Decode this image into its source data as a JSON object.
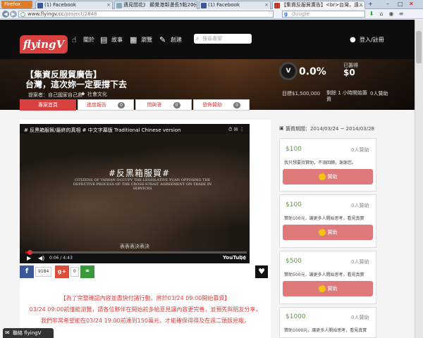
{
  "browser": {
    "menu_button": "Firefox",
    "tabs": [
      {
        "label": "(1) Facebook",
        "active": false
      },
      {
        "label": "遇見間花》 顯覺港鄰漫長5點20分轉...",
        "active": false
      },
      {
        "label": "(1) Facebook",
        "active": false
      },
      {
        "label": "【集資反服貿廣告】<br>台灣，遠...",
        "active": true
      }
    ],
    "url_host": "www.flyingv.cc",
    "url_path": "/project/2848",
    "search_placeholder": "Google"
  },
  "site": {
    "logo": "flyingV",
    "menu": [
      {
        "label": "關於",
        "icon": "hand-icon"
      },
      {
        "label": "故事",
        "icon": "book-icon"
      },
      {
        "label": "瀏覽",
        "icon": "grid-icon"
      },
      {
        "label": "創建",
        "icon": "edit-icon"
      }
    ],
    "search_placeholder": "搜尋專案",
    "login_label": "登入/註冊"
  },
  "project": {
    "title_line1": "【集資反服貿廣告】",
    "title_line2": "台灣，這次妳一定要撐下去",
    "proposer": "提案者：自己國家自己救",
    "tag": "社會文化",
    "gauge_label": "V",
    "percent": "0.0%",
    "raised_label": "已籌得",
    "raised_value": "$0",
    "goal": "目標$1,500,000",
    "time_left": "剩餘 1 小時開始籌資",
    "backers": "0人贊助"
  },
  "tabs": [
    {
      "label": "專案首頁",
      "count": null,
      "active": true
    },
    {
      "label": "進度報告",
      "count": "0",
      "active": false
    },
    {
      "label": "問與答",
      "count": "0",
      "active": false
    },
    {
      "label": "發佈贊助",
      "count": "0",
      "active": false
    }
  ],
  "video": {
    "title": "# 反黑箱服貿/最終的真相 # 中文字幕版 Traditional Chinese version",
    "overlay_title": "#反黑箱服貿#",
    "overlay_sub": "CITIZENS OF TAIWAN OCCUPY THE LEGISLATIVE YUAN OPPOSING THE DEFECTIVE PROCESS OF THE CROSS-STRAIT AGREEMENT ON TRADE IN SERVICES",
    "overlay_bottom": "表表表決表決",
    "time": "0:06 / 4:43",
    "played_fraction": 0.02,
    "yt_logo": "YouTube"
  },
  "share": {
    "facebook_count": "9184",
    "gplus_count": "0"
  },
  "notice": {
    "line1": "【為了完整確認內容並盡快付諸行動，將於03/24 09:00開始募資】",
    "line2": "03/24 09:00前僅能瀏覽，請各位夥伴在開始前多給意見讓內容更完善，並預先與朋友分享，",
    "line3": "我們非常希望能在03/24 19:00前達到150萬元，才能確保得得及在週二頭版見報。"
  },
  "sidebar": {
    "date_range": "籌資期間：2014/03/24 ~ 2014/03/28",
    "rewards": [
      {
        "price": "$100",
        "backers": "0人贊助",
        "desc": "我只想要持贊助，不須回饋，謝謝您。",
        "button": "贊助"
      },
      {
        "price": "$100",
        "backers": "0人贊助",
        "desc": "贊助100元，讓更多人開始思考，看見真實",
        "button": "贊助"
      },
      {
        "price": "$500",
        "backers": "0人贊助",
        "desc": "贊助500元，讓更多人開始思考，看見真實",
        "button": "贊助"
      },
      {
        "price": "$1000",
        "backers": "0人贊助",
        "desc": "贊助1000元，讓更多人開始思考，看見真實",
        "button": "贊助"
      }
    ]
  },
  "chat_label": "聯絡 flyingV",
  "colors": {
    "brand_red": "#d94141",
    "reward_button": "#e07a7a",
    "price_green": "#5a9a3a"
  }
}
